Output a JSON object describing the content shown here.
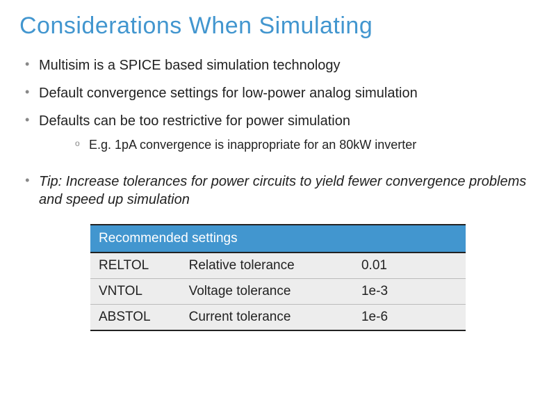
{
  "title": "Considerations When Simulating",
  "bullets": [
    "Multisim is a SPICE based simulation technology",
    "Default convergence settings for low-power analog simulation",
    "Defaults can be too restrictive for power simulation"
  ],
  "sub_bullet": "E.g. 1pA convergence is inappropriate for an 80kW inverter",
  "tip": "Tip: Increase tolerances for power circuits to yield fewer convergence problems and speed up simulation",
  "table": {
    "header": "Recommended settings",
    "rows": [
      {
        "param": "RELTOL",
        "desc": "Relative tolerance",
        "val": "0.01"
      },
      {
        "param": "VNTOL",
        "desc": "Voltage tolerance",
        "val": "1e-3"
      },
      {
        "param": "ABSTOL",
        "desc": "Current tolerance",
        "val": "1e-6"
      }
    ]
  }
}
